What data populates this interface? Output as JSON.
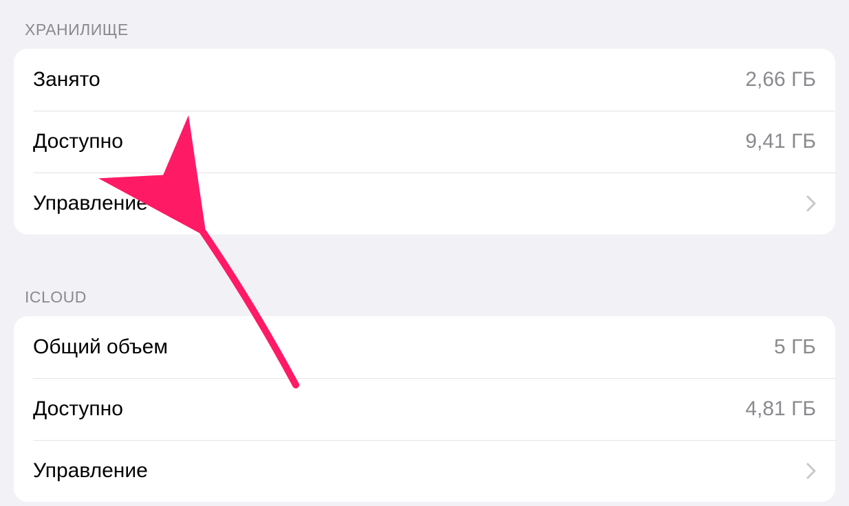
{
  "sections": {
    "storage": {
      "header": "ХРАНИЛИЩЕ",
      "rows": {
        "used": {
          "label": "Занято",
          "value": "2,66 ГБ"
        },
        "available": {
          "label": "Доступно",
          "value": "9,41 ГБ"
        },
        "manage": {
          "label": "Управление"
        }
      }
    },
    "icloud": {
      "header": "ICLOUD",
      "rows": {
        "total": {
          "label": "Общий объем",
          "value": "5 ГБ"
        },
        "available": {
          "label": "Доступно",
          "value": "4,81 ГБ"
        },
        "manage": {
          "label": "Управление"
        }
      }
    }
  },
  "colors": {
    "annotation": "#ff1a66"
  }
}
